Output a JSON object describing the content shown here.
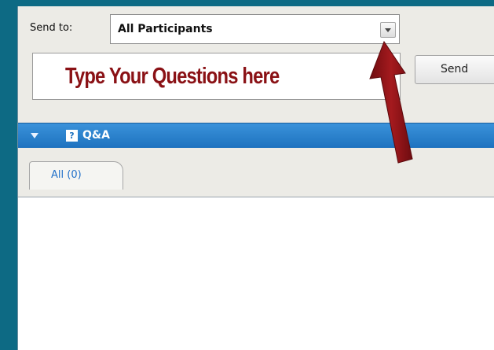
{
  "send_to": {
    "label": "Send to:",
    "selected": "All Participants"
  },
  "question_input": {
    "placeholder": "Type Your Questions here"
  },
  "send_button": {
    "label": "Send"
  },
  "qa_panel": {
    "title": "Q&A",
    "icon_glyph": "?",
    "tabs": [
      {
        "label": "All (0)"
      }
    ]
  },
  "colors": {
    "background": "#0d6a84",
    "header_blue": "#1e72bf",
    "annotation_red": "#8a1115",
    "tab_text": "#2271c9"
  },
  "icons": [
    "chevron-down-icon",
    "collapse-triangle-icon",
    "help-question-icon",
    "annotation-arrow"
  ]
}
